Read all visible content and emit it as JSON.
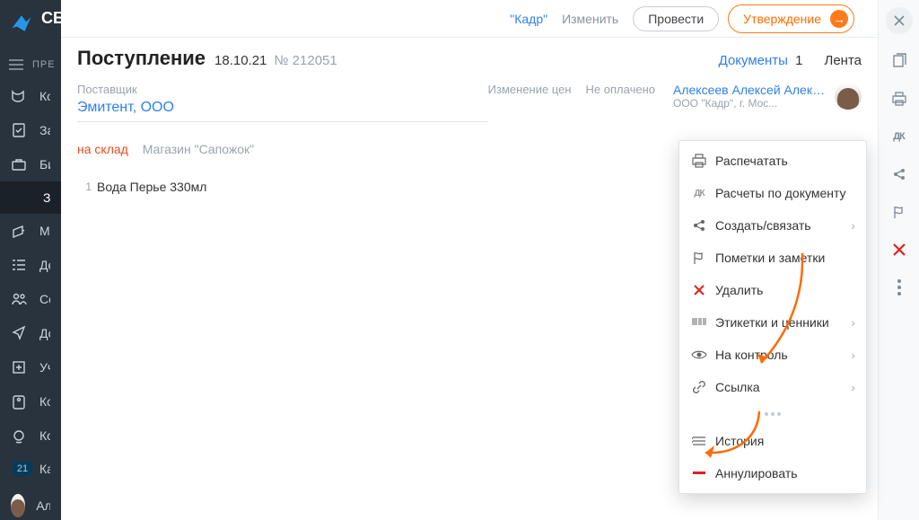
{
  "app_initials": "СБ",
  "sidebar_pre": "ПРЕ",
  "sidebar": [
    {
      "label": "Ко"
    },
    {
      "label": "Зад"
    },
    {
      "label": "Биз"
    },
    {
      "label": "Зак"
    },
    {
      "label": "Ма"
    },
    {
      "label": "Де"
    },
    {
      "label": "Сот"
    },
    {
      "label": "До"
    },
    {
      "label": "Уч"
    },
    {
      "label": "Ко"
    },
    {
      "label": "Ко"
    },
    {
      "label": "Кал"
    }
  ],
  "calendar_day": "21",
  "user_name_short": "Але",
  "topbar": {
    "org": "\"Кадр\"",
    "change": "Изменить",
    "run": "Провести",
    "approve": "Утверждение"
  },
  "doc_header": {
    "title": "Поступление",
    "date": "18.10.21",
    "num_prefix": "№",
    "num": "212051",
    "docs_label": "Документы",
    "docs_count": "1",
    "feed": "Лента"
  },
  "supplier": {
    "label": "Поставщик",
    "name": "Эмитент, ООО"
  },
  "status": {
    "price_change": "Изменение цен",
    "unpaid": "Не оплачено"
  },
  "owner": {
    "name": "Алексеев Алексей Алекс...",
    "org": "ООО \"Кадр\", г. Мос..."
  },
  "destination": {
    "label": "на склад",
    "value": "Магазин \"Сапожок\""
  },
  "items": [
    {
      "idx": "1",
      "name": "Вода Перье 330мл"
    }
  ],
  "menu": {
    "print": "Распечатать",
    "dk": "Расчеты по документу",
    "create": "Создать/связать",
    "notes": "Пометки и заметки",
    "delete": "Удалить",
    "labels": "Этикетки и ценники",
    "control": "На контроль",
    "link": "Ссылка",
    "history": "История",
    "annul": "Аннулировать",
    "dk_abbr": "ДК"
  },
  "rail": {
    "dk": "ДК"
  }
}
